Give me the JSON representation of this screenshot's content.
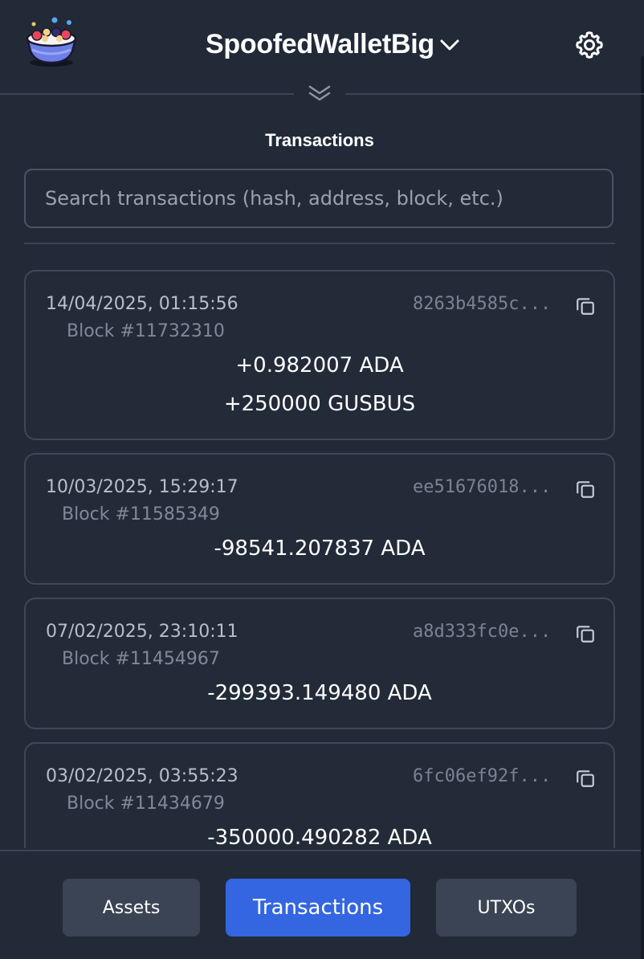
{
  "header": {
    "wallet_name": "SpoofedWalletBig"
  },
  "section_title": "Transactions",
  "search": {
    "placeholder": "Search transactions (hash, address, block, etc.)"
  },
  "transactions": [
    {
      "date": "14/04/2025, 01:15:56",
      "block": "Block #11732310",
      "hash": "8263b4585c...",
      "amounts": [
        "+0.982007 ADA",
        "+250000 GUSBUS"
      ]
    },
    {
      "date": "10/03/2025, 15:29:17",
      "block": "Block #11585349",
      "hash": "ee51676018...",
      "amounts": [
        "-98541.207837 ADA"
      ]
    },
    {
      "date": "07/02/2025, 23:10:11",
      "block": "Block #11454967",
      "hash": "a8d333fc0e...",
      "amounts": [
        "-299393.149480 ADA"
      ]
    },
    {
      "date": "03/02/2025, 03:55:23",
      "block": "Block #11434679",
      "hash": "6fc06ef92f...",
      "amounts": [
        "-350000.490282 ADA"
      ]
    }
  ],
  "nav": {
    "assets": "Assets",
    "transactions": "Transactions",
    "utxos": "UTXOs"
  },
  "colors": {
    "background": "#222a38",
    "active_tab": "#3366e0",
    "tab": "#3b4454"
  }
}
